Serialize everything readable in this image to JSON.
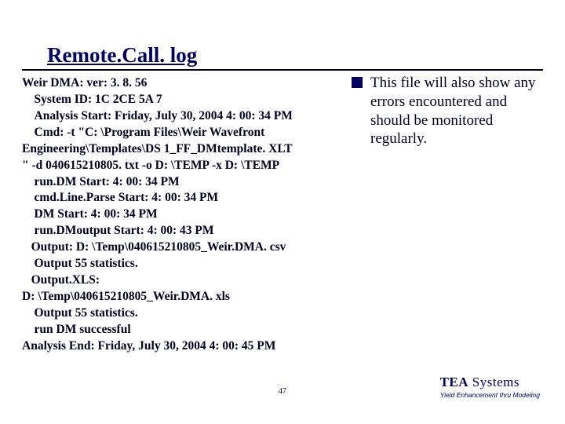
{
  "title": "Remote.Call. log",
  "log_text": "Weir DMA: ver: 3. 8. 56\n    System ID: 1C 2CE 5A 7\n    Analysis Start: Friday, July 30, 2004 4: 00: 34 PM\n    Cmd: -t \"C: \\Program Files\\Weir Wavefront\nEngineering\\Templates\\DS 1_FF_DMtemplate. XLT\n\" -d 040615210805. txt -o D: \\TEMP -x D: \\TEMP\n    run.DM Start: 4: 00: 34 PM\n    cmd.Line.Parse Start: 4: 00: 34 PM\n    DM Start: 4: 00: 34 PM\n    run.DMoutput Start: 4: 00: 43 PM\n   Output: D: \\Temp\\040615210805_Weir.DMA. csv\n    Output 55 statistics.\n   Output.XLS:\nD: \\Temp\\040615210805_Weir.DMA. xls\n    Output 55 statistics.\n    run DM successful\nAnalysis End: Friday, July 30, 2004 4: 00: 45 PM",
  "bullet_text": "This file will also show any errors encountered and should be monitored regularly.",
  "page_number": "47",
  "brand": {
    "name_strong": "TEA",
    "name_rest": " Systems",
    "tagline": "Yield Enhancement thru Modeling"
  }
}
